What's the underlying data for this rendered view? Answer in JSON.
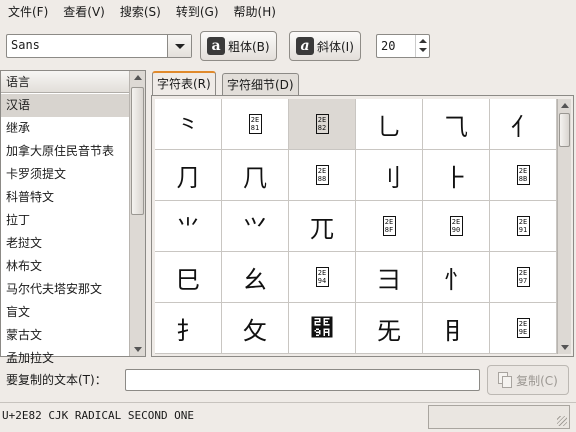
{
  "menu": {
    "items": [
      "文件(F)",
      "查看(V)",
      "搜索(S)",
      "转到(G)",
      "帮助(H)"
    ]
  },
  "toolbar": {
    "font_name": "Sans",
    "bold_label": "粗体(B)",
    "italic_label": "斜体(I)",
    "bold_glyph": "a",
    "italic_glyph": "a",
    "font_size": "20"
  },
  "languages": {
    "header": "语言",
    "items": [
      "汉语",
      "继承",
      "加拿大原住民音节表",
      "卡罗须提文",
      "科普特文",
      "拉丁",
      "老挝文",
      "林布文",
      "马尔代夫塔安那文",
      "盲文",
      "蒙古文",
      "孟加拉文"
    ],
    "selected_index": 0
  },
  "tabs": {
    "table": "字符表(R)",
    "details": "字符细节(D)"
  },
  "grid": {
    "selected_index": 2,
    "cells": [
      {
        "char": "⺀"
      },
      {
        "hex": [
          "2E",
          "81"
        ]
      },
      {
        "hex": [
          "2E",
          "82"
        ]
      },
      {
        "char": "⺃"
      },
      {
        "char": "⺄"
      },
      {
        "char": "⺅"
      },
      {
        "char": "⺆"
      },
      {
        "char": "⺇"
      },
      {
        "hex": [
          "2E",
          "88"
        ]
      },
      {
        "char": "⺉"
      },
      {
        "char": "⺊"
      },
      {
        "hex": [
          "2E",
          "8B"
        ]
      },
      {
        "char": "⺌"
      },
      {
        "char": "⺍"
      },
      {
        "char": "⺎"
      },
      {
        "hex": [
          "2E",
          "8F"
        ]
      },
      {
        "hex": [
          "2E",
          "90"
        ]
      },
      {
        "hex": [
          "2E",
          "91"
        ]
      },
      {
        "char": "⺒"
      },
      {
        "char": "⺓"
      },
      {
        "hex": [
          "2E",
          "94"
        ]
      },
      {
        "char": "⺕"
      },
      {
        "char": "⺖"
      },
      {
        "hex": [
          "2E",
          "97"
        ]
      },
      {
        "char": "⺘"
      },
      {
        "char": "⺙"
      },
      {
        "char": "⺚"
      },
      {
        "char": "⺛"
      },
      {
        "char": "⺝"
      },
      {
        "hex": [
          "2E",
          "9E"
        ]
      }
    ]
  },
  "copy": {
    "label": "要复制的文本(T)：",
    "value": "",
    "button_label": "复制(C)"
  },
  "status": {
    "text": "U+2E82 CJK RADICAL SECOND ONE"
  }
}
